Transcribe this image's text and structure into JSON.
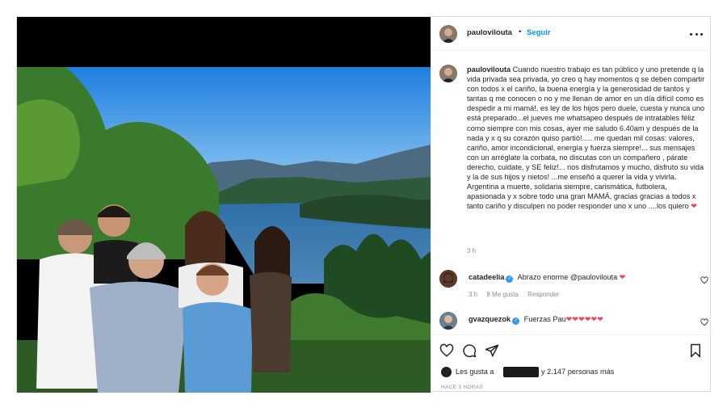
{
  "post": {
    "username": "paulovilouta",
    "separator": "•",
    "follow_label": "Seguir",
    "more_icon": "more-horizontal-icon",
    "caption": {
      "username": "paulovilouta",
      "text": "Cuando nuestro trabajo es tan público y uno pretende q la vida privada sea privada, yo creo q hay momentos q se deben compartir con todos x el cariño, la buena energía y la generosidad de tantos y tantas q me conocen o no y me llenan de amor en un día difícil como es despedir a mi mamá!, es ley de los hijos pero duele, cuesta y nunca uno está preparado...el jueves me whatsapeo después de intratables féliz como siempre con mis cosas, ayer me saludo 6.40am y después de la nada y x q su corazón quiso partió!..... me quedan mil cosas: valores, cariño, amor incondicional, energía y fuerza siempre!... sus mensajes con un arréglate la corbata, no discutas con un compañero , párate derecho, cuidate, y SE feliz!... nos disfrutamos y mucho, disfruto su vida y la de sus hijos y nietos! ...me enseñó a querer la vida y vivirla. Argentina a muerte, solidaria siempre, carismática, futbolera, apasionada y x sobre todo una gran MAMÁ, gracias gracias a todos x tanto cariño y disculpen no poder responder uno x uno ....los quiero",
      "heart": "❤",
      "time": "3 h"
    },
    "comments": [
      {
        "username": "catadeelia",
        "verified_mark": "✓",
        "text": "Abrazo enorme @paulovilouta",
        "emoji": "❤",
        "time": "3 h",
        "likes": "8 Me gusta",
        "reply": "Responder"
      },
      {
        "username": "gvazquezok",
        "verified_mark": "✓",
        "text": "Fuerzas Pau",
        "emoji": "❤❤❤❤❤❤"
      }
    ],
    "likes": {
      "prefix": "Les gusta a",
      "suffix": "y 2.147 personas más"
    },
    "posted_ago": "HACE 3 HORAS"
  },
  "colors": {
    "link_blue": "#0095f6",
    "heart_red": "#ed4956",
    "muted_gray": "#8e8e8e"
  }
}
